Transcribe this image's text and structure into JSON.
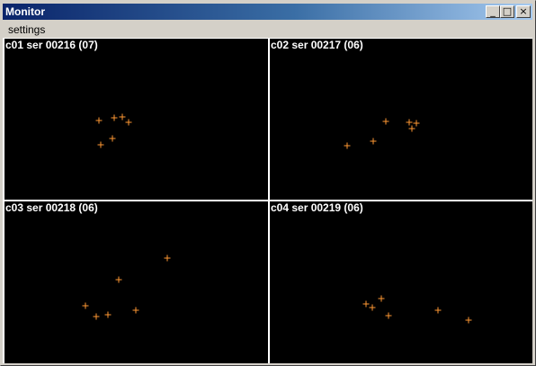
{
  "window": {
    "title": "Monitor",
    "buttons": {
      "minimize": "_",
      "maximize": "□",
      "close": "×"
    }
  },
  "menu": {
    "items": [
      "settings"
    ]
  },
  "colors": {
    "marker": "#ff9933",
    "panel_background": "#000000"
  },
  "panels": [
    {
      "label": "c01 ser 00216 (07)"
    },
    {
      "label": "c02 ser 00217 (06)"
    },
    {
      "label": "c03 ser 00218 (06)"
    },
    {
      "label": "c04 ser 00219 (06)"
    }
  ]
}
